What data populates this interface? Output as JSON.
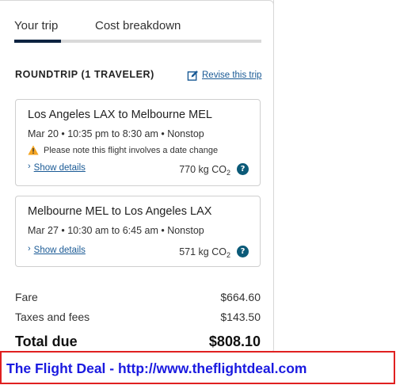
{
  "tabs": [
    {
      "label": "Your trip",
      "active": true
    },
    {
      "label": "Cost breakdown",
      "active": false
    }
  ],
  "trip": {
    "heading": "ROUNDTRIP (1 TRAVELER)",
    "revise_label": "Revise this trip",
    "flights": [
      {
        "route": "Los Angeles LAX to Melbourne MEL",
        "times": "Mar 20 • 10:35 pm to 8:30 am • Nonstop",
        "warning": "Please note this flight involves a date change",
        "details_label": "Show details",
        "co2_value": "770 kg CO",
        "co2_sub": "2"
      },
      {
        "route": "Melbourne MEL to Los Angeles LAX",
        "times": "Mar 27 • 10:30 am to 6:45 am • Nonstop",
        "details_label": "Show details",
        "co2_value": "571 kg CO",
        "co2_sub": "2"
      }
    ]
  },
  "costs": {
    "fare_label": "Fare",
    "fare_value": "$664.60",
    "taxes_label": "Taxes and fees",
    "taxes_value": "$143.50",
    "total_label": "Total due",
    "total_value": "$808.10"
  },
  "banner": {
    "text": "The Flight Deal - http://www.theflightdeal.com"
  },
  "colors": {
    "link": "#1a5a95",
    "tab_active": "#0c2340",
    "help_icon": "#0b5a78",
    "warning": "#f5a623",
    "banner_border": "#e02020",
    "banner_text": "#1a1ae0"
  },
  "icons": {
    "revise": "edit-icon",
    "warning": "warning-icon",
    "details": "chevron-right-icon",
    "help": "question-icon"
  }
}
